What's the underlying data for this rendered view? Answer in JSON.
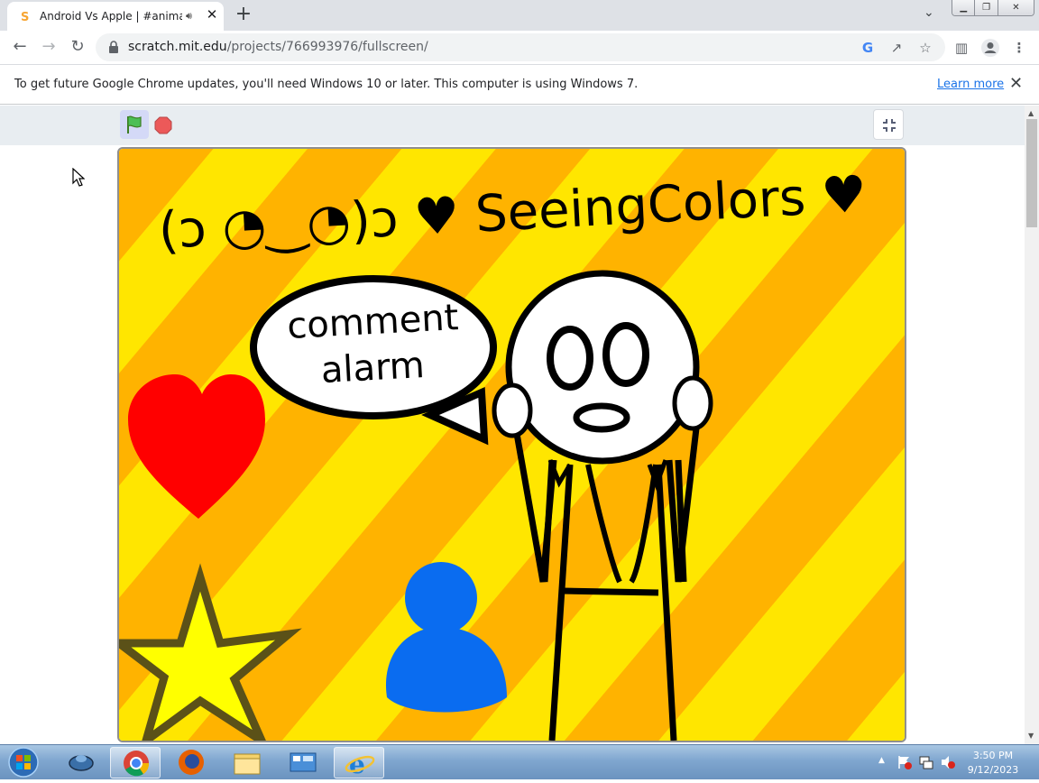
{
  "browser": {
    "tab_title": "Android Vs Apple | #animatio",
    "tab_close": "✕",
    "new_tab": "+",
    "url_domain": "scratch.mit.edu",
    "url_path": "/projects/766993976/fullscreen/",
    "icons": [
      "back-icon",
      "forward-icon",
      "reload-icon",
      "lock-icon",
      "google-icon",
      "share-icon",
      "star-icon",
      "sidepanel-icon",
      "profile-icon",
      "menu-icon"
    ]
  },
  "infobar": {
    "message": "To get future Google Chrome updates, you'll need Windows 10 or later. This computer is using Windows 7.",
    "link": "Learn more",
    "close": "✕"
  },
  "stage": {
    "title_text": "(ɔ ◔‿◔)ɔ ♥ SeeingColors ♥",
    "speech_line1": "comment",
    "speech_line2": "alarm",
    "colors": {
      "yellow": "#ffe600",
      "orange": "#ffb300",
      "heart": "#ff0000",
      "person": "#0a6cf0",
      "star": "#ffff00"
    }
  },
  "taskbar": {
    "time": "3:50 PM",
    "date": "9/12/2023",
    "apps": [
      "start-button",
      "unknown-app",
      "chrome",
      "firefox",
      "file-explorer",
      "control-panel",
      "internet-explorer"
    ]
  }
}
